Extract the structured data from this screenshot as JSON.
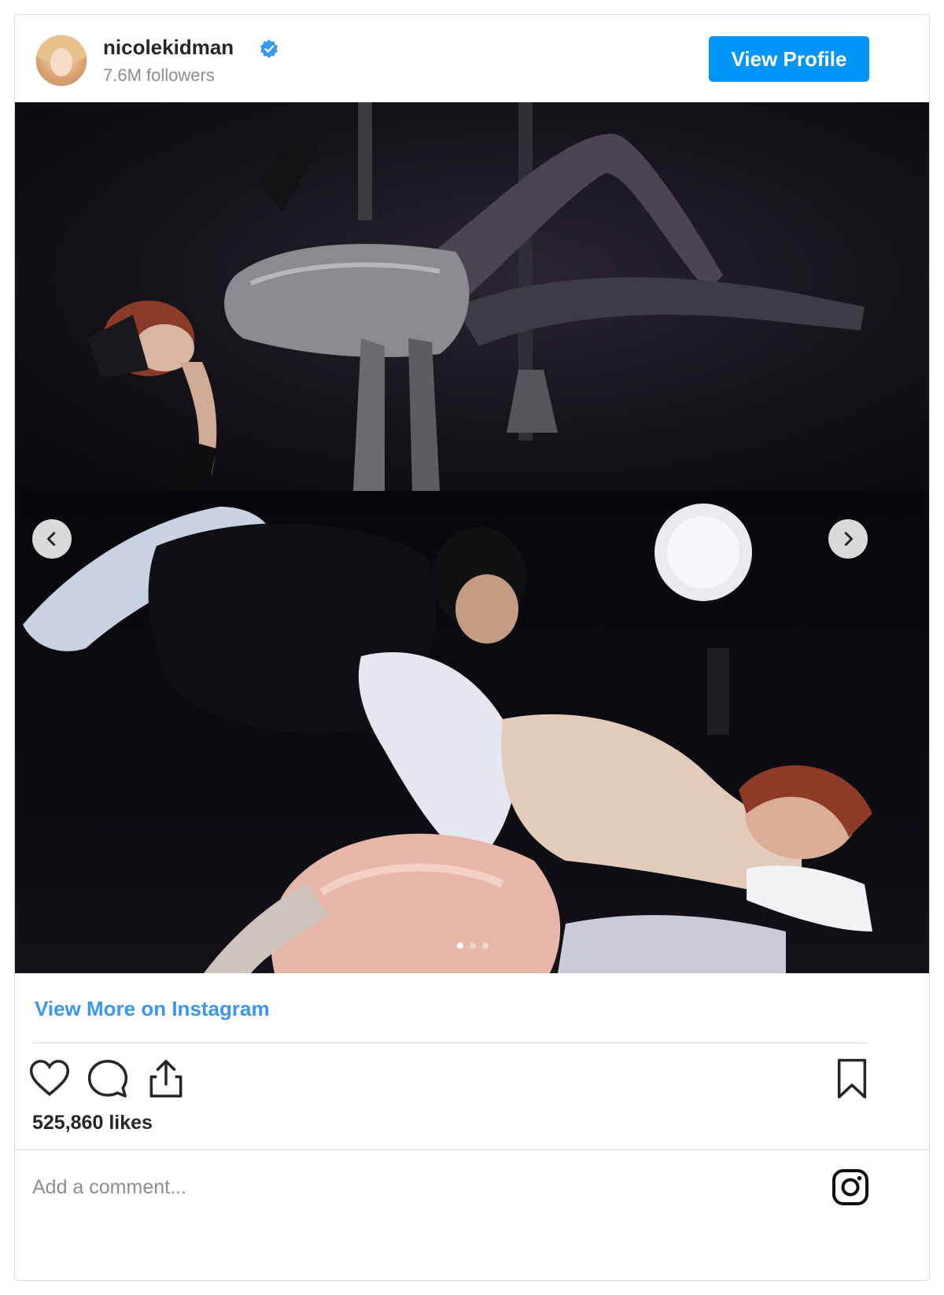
{
  "header": {
    "username": "nicolekidman",
    "followers": "7.6M followers",
    "view_profile_label": "View Profile"
  },
  "media": {
    "slide_count": 3,
    "active_slide": 1
  },
  "footer": {
    "view_more_label": "View More on Instagram",
    "likes": "525,860 likes",
    "comment_placeholder": "Add a comment..."
  },
  "icons": {
    "verified": "verified-badge-icon",
    "like": "heart-icon",
    "comment": "comment-bubble-icon",
    "share": "share-icon",
    "save": "bookmark-icon",
    "brand": "instagram-icon",
    "prev": "chevron-left-icon",
    "next": "chevron-right-icon"
  },
  "colors": {
    "accent": "#0095f6",
    "link": "#3897f0",
    "text": "#262626",
    "muted": "#8e8e8e",
    "border": "#dbdbdb"
  }
}
